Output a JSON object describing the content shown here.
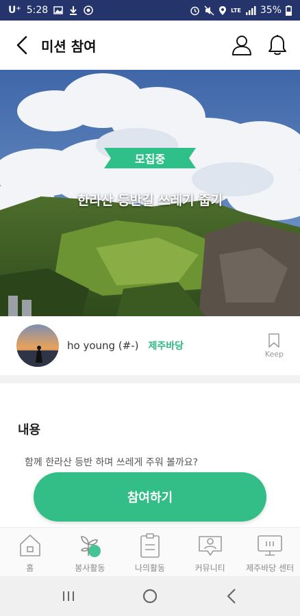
{
  "status_bar": {
    "carrier": "U⁺",
    "time": "5:28",
    "lte": "LTE",
    "battery": "35%"
  },
  "header": {
    "title": "미션 참여",
    "icons": [
      "back-arrow-icon",
      "user-icon",
      "bell-icon"
    ]
  },
  "hero": {
    "badge": "모집중",
    "title": "한라산 등반길 쓰레기 줍기"
  },
  "author": {
    "name": "ho young (#-)",
    "organization": "제주바당",
    "keep_label": "Keep"
  },
  "content": {
    "heading": "내용",
    "text": "함께 한라산 등반 하며 쓰레게 주워 볼까요?"
  },
  "join_button": "참여하기",
  "bottom_nav": {
    "items": [
      {
        "label": "홈",
        "icon": "home-icon"
      },
      {
        "label": "봉사활동",
        "icon": "sprout-icon"
      },
      {
        "label": "나의활동",
        "icon": "clipboard-icon"
      },
      {
        "label": "커뮤니티",
        "icon": "community-icon"
      },
      {
        "label": "제주바당 센터",
        "icon": "center-icon"
      }
    ]
  },
  "colors": {
    "accent": "#33be87",
    "status_bar": "#25356b",
    "org_text": "#31b985"
  }
}
